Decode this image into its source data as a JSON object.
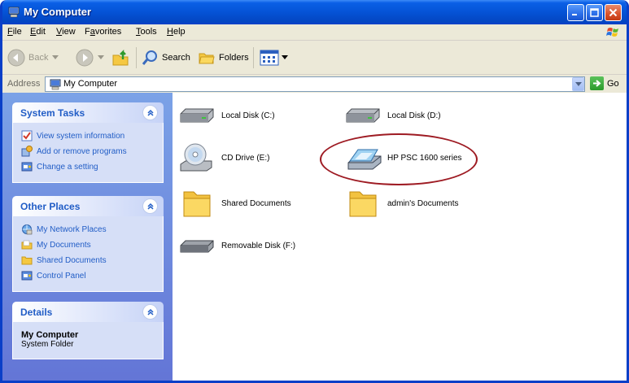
{
  "window": {
    "title": "My Computer",
    "buttons": {
      "minimize": "minimize",
      "maximize": "maximize",
      "close": "close"
    }
  },
  "menubar": {
    "items": [
      {
        "label": "File",
        "accel": "F",
        "rest": "ile"
      },
      {
        "label": "Edit",
        "accel": "E",
        "rest": "dit"
      },
      {
        "label": "View",
        "accel": "V",
        "rest": "iew"
      },
      {
        "label": "Favorites",
        "pre": "F",
        "accel": "a",
        "rest": "vorites"
      },
      {
        "label": "Tools",
        "accel": "T",
        "rest": "ools"
      },
      {
        "label": "Help",
        "accel": "H",
        "rest": "elp"
      }
    ]
  },
  "toolbar": {
    "back_label": "Back",
    "search_label": "Search",
    "folders_label": "Folders"
  },
  "address": {
    "label": "Address",
    "value": "My Computer",
    "go_label": "Go"
  },
  "tasks": {
    "system": {
      "title": "System Tasks",
      "items": [
        {
          "label": "View system information",
          "icon": "system-info-icon"
        },
        {
          "label": "Add or remove programs",
          "icon": "add-remove-programs-icon"
        },
        {
          "label": "Change a setting",
          "icon": "control-panel-icon"
        }
      ]
    },
    "other": {
      "title": "Other Places",
      "items": [
        {
          "label": "My Network Places",
          "icon": "network-places-icon"
        },
        {
          "label": "My Documents",
          "icon": "my-documents-icon"
        },
        {
          "label": "Shared Documents",
          "icon": "folder-icon"
        },
        {
          "label": "Control Panel",
          "icon": "control-panel-icon"
        }
      ]
    },
    "details": {
      "title": "Details",
      "name": "My Computer",
      "type": "System Folder"
    }
  },
  "items": {
    "local_c": {
      "label": "Local Disk (C:)",
      "icon": "hard-disk-icon"
    },
    "local_d": {
      "label": "Local Disk (D:)",
      "icon": "hard-disk-icon"
    },
    "cd_e": {
      "label": "CD Drive (E:)",
      "icon": "cd-drive-icon"
    },
    "hp_psc": {
      "label": "HP PSC 1600 series",
      "icon": "scanner-icon"
    },
    "shared_docs": {
      "label": "Shared Documents",
      "icon": "folder-icon"
    },
    "admin_docs": {
      "label": "admin's Documents",
      "icon": "folder-icon"
    },
    "removable_f": {
      "label": "Removable Disk (F:)",
      "icon": "removable-disk-icon"
    }
  },
  "colors": {
    "title_blue": "#0a5fe6",
    "task_pane": "#7ba2e7",
    "link_blue": "#215dc6",
    "highlight_circle": "#9e1b23"
  }
}
